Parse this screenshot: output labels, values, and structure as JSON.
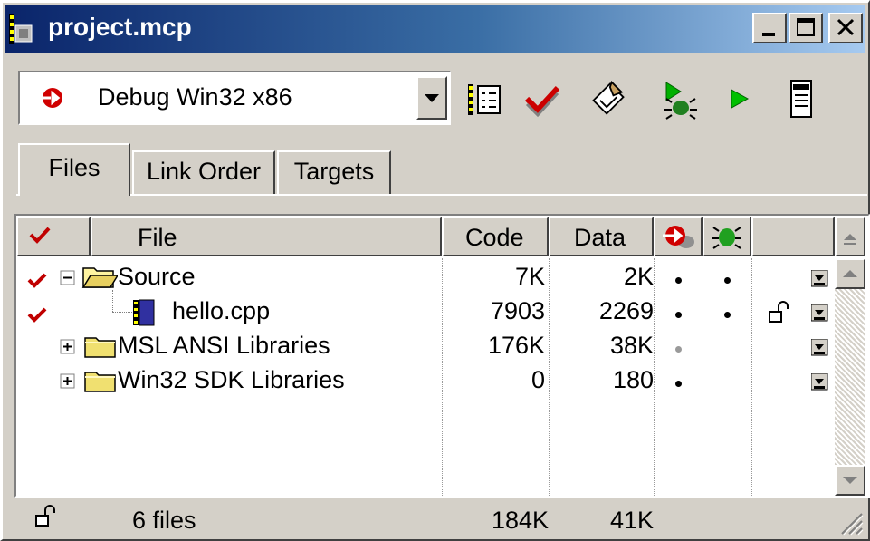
{
  "window": {
    "title": "project.mcp",
    "minimize_icon": "minimize-icon",
    "maximize_icon": "maximize-icon",
    "close_icon": "close-icon"
  },
  "toolbar": {
    "target_select": {
      "value": "Debug Win32 x86",
      "icon": "target-icon"
    },
    "tools": [
      "target-settings-icon",
      "synchronize-modification-dates-icon",
      "make-icon",
      "debug-icon",
      "run-icon",
      "project-inspector-icon"
    ]
  },
  "tabs": [
    {
      "label": "Files",
      "active": true
    },
    {
      "label": "Link Order",
      "active": false
    },
    {
      "label": "Targets",
      "active": false
    }
  ],
  "columns": {
    "touch_icon": "checkmark-icon",
    "file": "File",
    "code": "Code",
    "data": "Data",
    "target_icon": "target-icon",
    "debug_icon": "bug-icon"
  },
  "rows": [
    {
      "touched": true,
      "expander": "⊟",
      "icon": "open-folder-icon",
      "name": "Source",
      "code": "7K",
      "data": "2K",
      "in_target": "black",
      "debug": true,
      "locked": false,
      "menu": true
    },
    {
      "touched": true,
      "expander": "",
      "icon": "file-icon",
      "name": "hello.cpp",
      "code": "7903",
      "data": "2269",
      "in_target": "black",
      "debug": true,
      "locked": true,
      "menu": true
    },
    {
      "touched": false,
      "expander": "⊞",
      "icon": "folder-icon",
      "name": "MSL ANSI Libraries",
      "code": "176K",
      "data": "38K",
      "in_target": "gray",
      "debug": false,
      "locked": false,
      "menu": true
    },
    {
      "touched": false,
      "expander": "⊞",
      "icon": "folder-icon",
      "name": "Win32 SDK Libraries",
      "code": "0",
      "data": "180",
      "in_target": "black",
      "debug": false,
      "locked": false,
      "menu": true
    }
  ],
  "status": {
    "lock_icon": "unlocked-icon",
    "files": "6 files",
    "code_total": "184K",
    "data_total": "41K"
  },
  "colors": {
    "title_gradient_start": "#0a246a",
    "title_gradient_end": "#a6caf0",
    "checkmark": "#c00000",
    "face": "#d4d0c8"
  }
}
